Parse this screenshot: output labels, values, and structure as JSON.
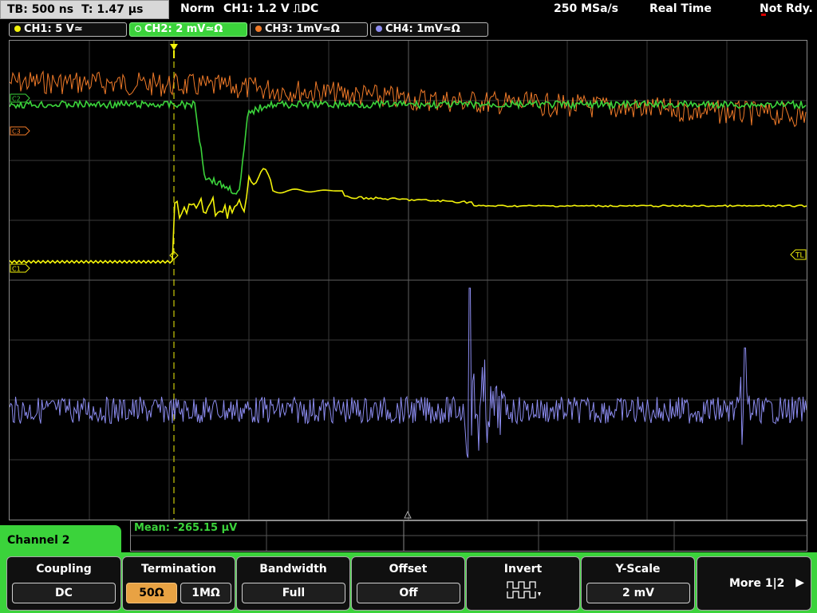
{
  "status": {
    "timebase": "TB: 500 ns",
    "trigger_time": "T: 1.47 µs",
    "mode": "Norm",
    "trigger": "CH1: 1.2 V ⎍DC",
    "sample_rate": "250 MSa/s",
    "acq_mode": "Real Time",
    "ready": "Not Rdy."
  },
  "channels": [
    {
      "label": "CH1: 5 V≃",
      "color": "#f2f20a"
    },
    {
      "label": "CH2: 2 mV≃Ω",
      "color": "#3bd33b"
    },
    {
      "label": "CH3: 1mV≃Ω",
      "color": "#f07a28"
    },
    {
      "label": "CH4: 1mV≃Ω",
      "color": "#8c8cf0"
    }
  ],
  "markers": {
    "c1": "C1",
    "c2": "C2",
    "c3": "C3",
    "tl": "TL"
  },
  "measurement": {
    "mean": "Mean: -265.15 µV"
  },
  "menu": {
    "title": "Channel 2",
    "coupling": {
      "title": "Coupling",
      "value": "DC"
    },
    "termination": {
      "title": "Termination",
      "opt1": "50Ω",
      "opt2": "1MΩ"
    },
    "bandwidth": {
      "title": "Bandwidth",
      "value": "Full"
    },
    "offset": {
      "title": "Offset",
      "value": "Off"
    },
    "invert": {
      "title": "Invert"
    },
    "yscale": {
      "title": "Y-Scale",
      "value": "2 mV"
    },
    "more": "More 1|2"
  }
}
